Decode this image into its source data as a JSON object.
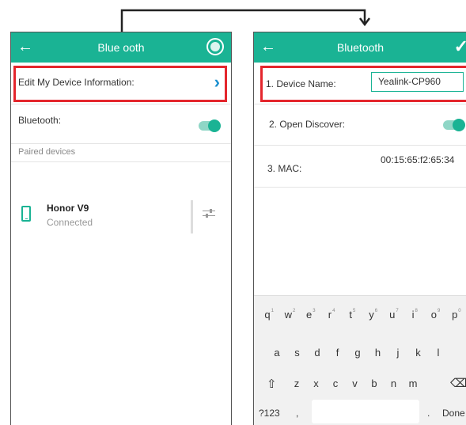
{
  "left": {
    "titlebar": {
      "title": "Blue  ooth"
    },
    "edit_row_label": "Edit My Device Information:",
    "bluetooth_label": "Bluetooth:",
    "paired_section": "Paired devices",
    "device": {
      "name": "Honor V9",
      "status": "Connected"
    }
  },
  "right": {
    "titlebar": {
      "title": "Bluetooth"
    },
    "fields": {
      "device_name_label": "1. Device Name:",
      "device_name_value": "Yealink-CP960",
      "open_discover_label": "2. Open Discover:",
      "mac_label": "3. MAC:",
      "mac_value": "00:15:65:f2:65:34"
    },
    "keyboard": {
      "row1": [
        "q",
        "w",
        "e",
        "r",
        "t",
        "y",
        "u",
        "i",
        "o",
        "p"
      ],
      "row1_hints": [
        "1",
        "2",
        "3",
        "4",
        "5",
        "6",
        "7",
        "8",
        "9",
        "0"
      ],
      "row2": [
        "a",
        "s",
        "d",
        "f",
        "g",
        "h",
        "j",
        "k",
        "l"
      ],
      "row3": [
        "z",
        "x",
        "c",
        "v",
        "b",
        "n",
        "m"
      ],
      "shift": "⇧",
      "backspace": "⌫",
      "symbols": "?123",
      "comma": ",",
      "period": ".",
      "done": "Done"
    }
  },
  "colors": {
    "accent": "#1ab394",
    "highlight": "#e4262d",
    "chevron": "#1a8fcf"
  },
  "icons": [
    "back-arrow-icon",
    "globe-icon",
    "check-icon",
    "chevron-right-icon",
    "phone-icon",
    "settings-sliders-icon",
    "shift-icon",
    "backspace-icon"
  ]
}
